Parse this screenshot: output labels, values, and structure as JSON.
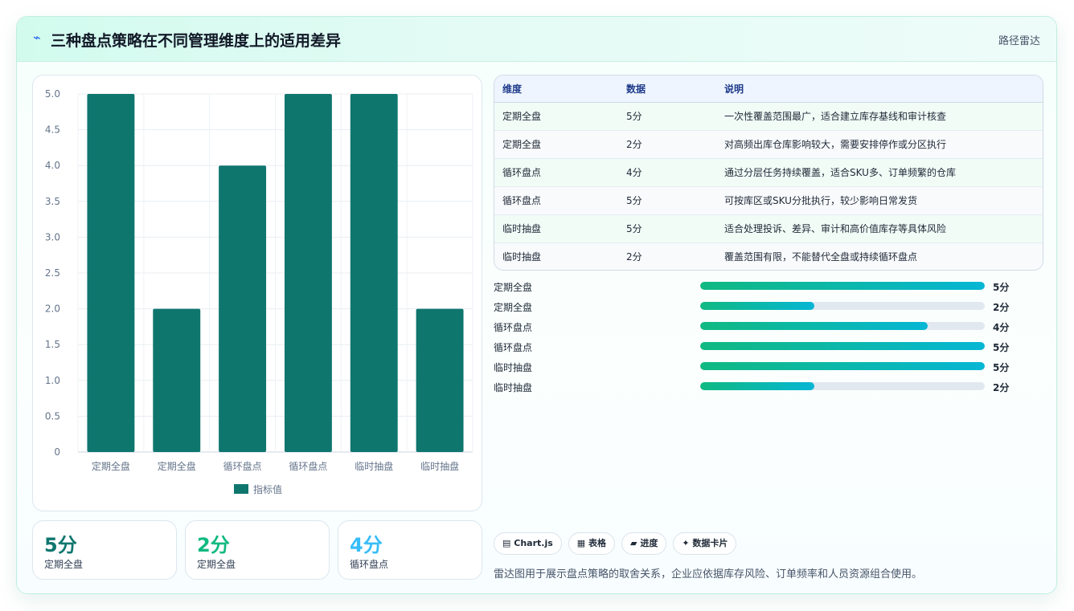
{
  "header": {
    "icon": "bolt-icon",
    "title": "三种盘点策略在不同管理维度上的适用差异",
    "tag": "路径雷达"
  },
  "chart_data": {
    "type": "bar",
    "categories": [
      "定期全盘",
      "定期全盘",
      "循环盘点",
      "循环盘点",
      "临时抽盘",
      "临时抽盘"
    ],
    "series": [
      {
        "name": "指标值",
        "values": [
          5,
          2,
          4,
          5,
          5,
          2
        ]
      }
    ],
    "ylim": [
      0,
      5
    ],
    "yticks": [
      "0",
      "0.5",
      "1.0",
      "1.5",
      "2.0",
      "2.5",
      "3.0",
      "3.5",
      "4.0",
      "4.5",
      "5.0"
    ],
    "grid": true,
    "legend": "bottom",
    "bar_color": "#0f766e"
  },
  "stats": [
    {
      "value": "5分",
      "label": "定期全盘",
      "color": "#0f766e"
    },
    {
      "value": "2分",
      "label": "定期全盘",
      "color": "#10b981"
    },
    {
      "value": "4分",
      "label": "循环盘点",
      "color": "#38bdf8"
    }
  ],
  "table": {
    "headers": [
      "维度",
      "数据",
      "说明"
    ],
    "rows": [
      [
        "定期全盘",
        "5分",
        "一次性覆盖范围最广，适合建立库存基线和审计核查"
      ],
      [
        "定期全盘",
        "2分",
        "对高频出库仓库影响较大，需要安排停作或分区执行"
      ],
      [
        "循环盘点",
        "4分",
        "通过分层任务持续覆盖，适合SKU多、订单频繁的仓库"
      ],
      [
        "循环盘点",
        "5分",
        "可按库区或SKU分批执行，较少影响日常发货"
      ],
      [
        "临时抽盘",
        "5分",
        "适合处理投诉、差异、审计和高价值库存等具体风险"
      ],
      [
        "临时抽盘",
        "2分",
        "覆盖范围有限，不能替代全盘或持续循环盘点"
      ]
    ]
  },
  "progress": [
    {
      "label": "定期全盘",
      "value": 5,
      "max": 5,
      "text": "5分"
    },
    {
      "label": "定期全盘",
      "value": 2,
      "max": 5,
      "text": "2分"
    },
    {
      "label": "循环盘点",
      "value": 4,
      "max": 5,
      "text": "4分"
    },
    {
      "label": "循环盘点",
      "value": 5,
      "max": 5,
      "text": "5分"
    },
    {
      "label": "临时抽盘",
      "value": 5,
      "max": 5,
      "text": "5分"
    },
    {
      "label": "临时抽盘",
      "value": 2,
      "max": 5,
      "text": "2分"
    }
  ],
  "chips": [
    {
      "icon": "chart-icon",
      "glyph": "▤",
      "label": "Chart.js"
    },
    {
      "icon": "table-icon",
      "glyph": "▦",
      "label": "表格"
    },
    {
      "icon": "progress-icon",
      "glyph": "▰",
      "label": "进度"
    },
    {
      "icon": "card-icon",
      "glyph": "✦",
      "label": "数据卡片"
    }
  ],
  "footnote": "雷达图用于展示盘点策略的取舍关系，企业应依据库存风险、订单频率和人员资源组合使用。"
}
